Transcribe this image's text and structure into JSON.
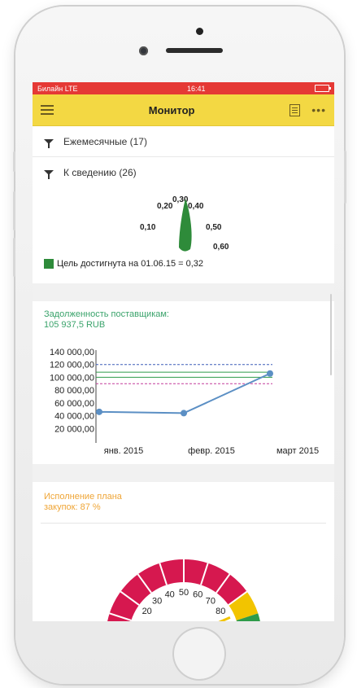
{
  "status": {
    "carrier": "Билайн LTE",
    "time": "16:41"
  },
  "header": {
    "title": "Монитор"
  },
  "filters": [
    {
      "label": "Ежемесячные (17)"
    },
    {
      "label": "К сведению (26)"
    }
  ],
  "gauge1": {
    "ticks": [
      "0,10",
      "0,20",
      "0,30",
      "0,40",
      "0,50",
      "0,60"
    ],
    "value": 0.32,
    "goal_text": "Цель достигнута на 01.06.15 = 0,32",
    "colors": {
      "needle": "#2e8b3a",
      "goal": "#2e8b3a"
    }
  },
  "debt": {
    "title": "Задолженность поставщикам:",
    "value": "105 937,5 RUB"
  },
  "chart_data": {
    "type": "line",
    "categories": [
      "янв. 2015",
      "февр. 2015",
      "март 2015"
    ],
    "y_ticks": [
      "140 000,00",
      "120 000,00",
      "100 000,00",
      "80 000,00",
      "60 000,00",
      "40 000,00",
      "20 000,00"
    ],
    "ylim": [
      0,
      140000
    ],
    "series": [
      {
        "values": [
          46000,
          44000,
          105937.5
        ],
        "color": "#5b8fc4"
      }
    ],
    "reference_lines": [
      {
        "value": 120000,
        "color": "#3f5fb8",
        "style": "dashed"
      },
      {
        "value": 108000,
        "color": "#2e9b4a",
        "style": "solid"
      },
      {
        "value": 100000,
        "color": "#2e9b4a",
        "style": "solid"
      },
      {
        "value": 90000,
        "color": "#c43c9b",
        "style": "dashed"
      }
    ]
  },
  "plan": {
    "title_line1": "Исполнение плана",
    "title_line2": "закупок: 87 %",
    "ticks": [
      "20",
      "30",
      "40",
      "50",
      "60",
      "70",
      "80"
    ],
    "value": 87,
    "colors": {
      "main": "#d6184f",
      "warn": "#f2c400",
      "ok": "#2e9b4a",
      "title": "#efa536"
    }
  }
}
